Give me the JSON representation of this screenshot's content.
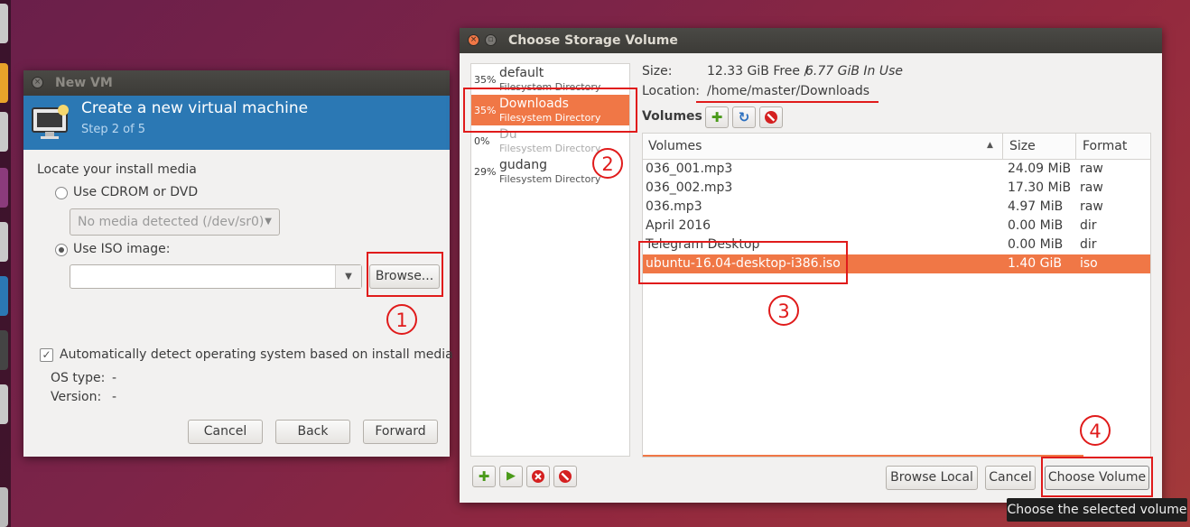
{
  "new_vm": {
    "title": "New VM",
    "banner_title": "Create a new virtual machine",
    "banner_step": "Step 2 of 5",
    "locate_label": "Locate your install media",
    "cdrom_label": "Use CDROM or DVD",
    "cdrom_select": "No media detected (/dev/sr0)",
    "iso_label": "Use ISO image:",
    "iso_value": "",
    "browse_label": "Browse...",
    "autodetect_label": "Automatically detect operating system based on install media",
    "os_type_label": "OS type:",
    "os_type_value": "-",
    "version_label": "Version:",
    "version_value": "-",
    "cancel_label": "Cancel",
    "back_label": "Back",
    "forward_label": "Forward"
  },
  "storage": {
    "title": "Choose Storage Volume",
    "pools": [
      {
        "pct": "35%",
        "name": "default",
        "desc": "Filesystem Directory"
      },
      {
        "pct": "35%",
        "name": "Downloads",
        "desc": "Filesystem Directory"
      },
      {
        "pct": "0%",
        "name": "Du",
        "desc": "Filesystem Directory"
      },
      {
        "pct": "29%",
        "name": "gudang",
        "desc": "Filesystem Directory"
      }
    ],
    "size_label": "Size:",
    "size_free": "12.33 GiB Free /",
    "size_used": "6.77 GiB In Use",
    "location_label": "Location:",
    "location_value": "/home/master/Downloads",
    "volumes_label": "Volumes",
    "columns": {
      "name": "Volumes",
      "size": "Size",
      "format": "Format"
    },
    "volumes": [
      {
        "name": "036_001.mp3",
        "size": "24.09 MiB",
        "format": "raw"
      },
      {
        "name": "036_002.mp3",
        "size": "17.30 MiB",
        "format": "raw"
      },
      {
        "name": "036.mp3",
        "size": "4.97 MiB",
        "format": "raw"
      },
      {
        "name": "April 2016",
        "size": "0.00 MiB",
        "format": "dir"
      },
      {
        "name": "Telegram Desktop",
        "size": "0.00 MiB",
        "format": "dir"
      },
      {
        "name": "ubuntu-16.04-desktop-i386.iso",
        "size": "1.40 GiB",
        "format": "iso"
      }
    ],
    "browse_local_label": "Browse Local",
    "cancel_label": "Cancel",
    "choose_label": "Choose Volume",
    "tooltip": "Choose the selected volume"
  },
  "annotations": {
    "n1": "1",
    "n2": "2",
    "n3": "3",
    "n4": "4"
  },
  "colors": {
    "accent": "#f07746",
    "banner": "#2b78b4",
    "annotation": "#e01b1b"
  },
  "icons": [
    "add-icon",
    "refresh-icon",
    "delete-icon",
    "start-icon",
    "stop-icon",
    "sort-arrow-icon",
    "computer-icon"
  ]
}
